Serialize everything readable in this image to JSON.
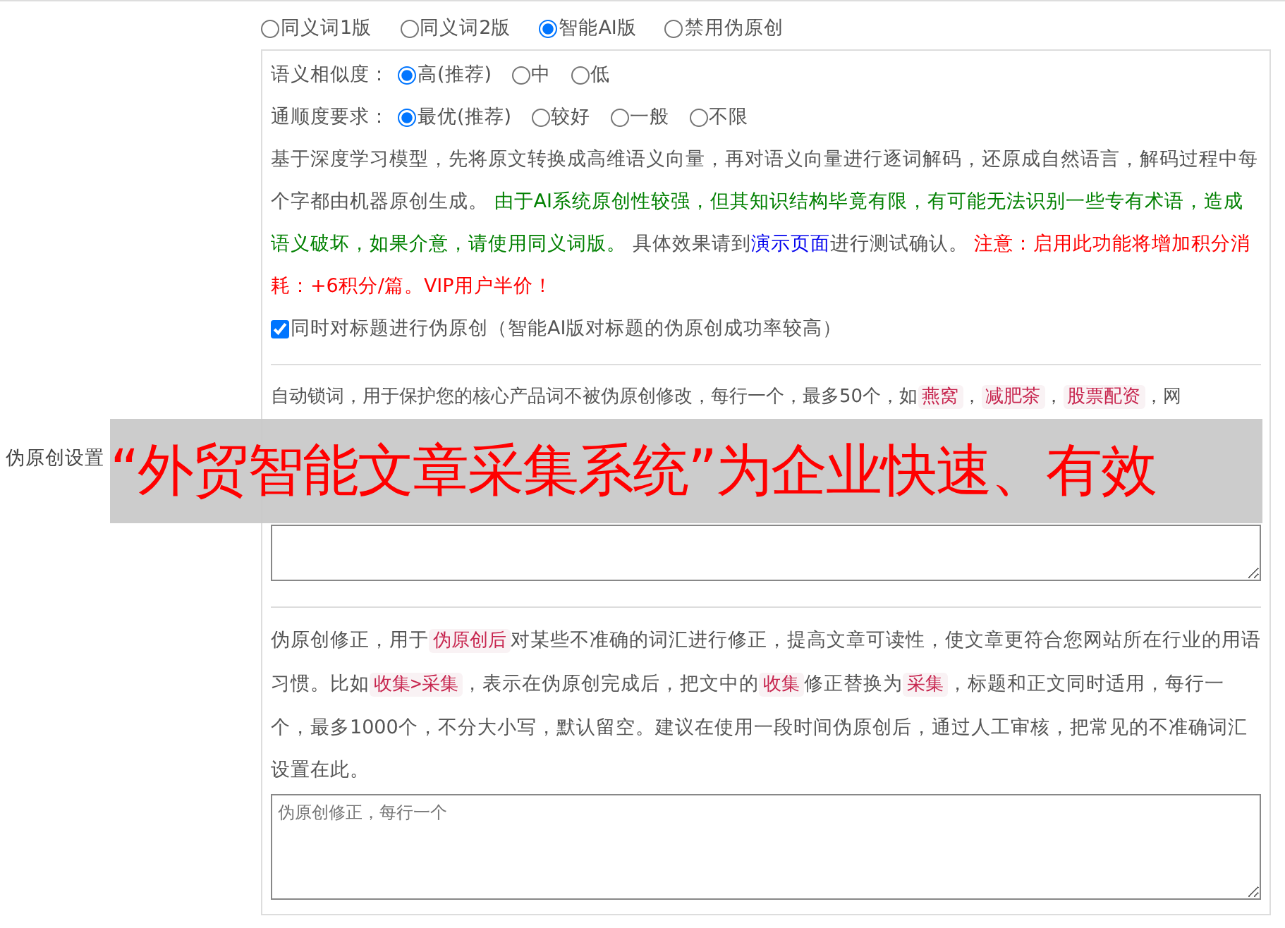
{
  "section_label": "伪原创设置",
  "modes": [
    {
      "label": "同义词1版",
      "selected": false
    },
    {
      "label": "同义词2版",
      "selected": false
    },
    {
      "label": "智能AI版",
      "selected": true
    },
    {
      "label": "禁用伪原创",
      "selected": false
    }
  ],
  "similarity": {
    "label": "语义相似度：",
    "options": [
      {
        "label": "高(推荐)",
        "selected": true
      },
      {
        "label": "中",
        "selected": false
      },
      {
        "label": "低",
        "selected": false
      }
    ]
  },
  "fluency": {
    "label": "通顺度要求：",
    "options": [
      {
        "label": "最优(推荐)",
        "selected": true
      },
      {
        "label": "较好",
        "selected": false
      },
      {
        "label": "一般",
        "selected": false
      },
      {
        "label": "不限",
        "selected": false
      }
    ]
  },
  "description": [
    {
      "kind": "plain",
      "text": "基于深度学习模型，先将原文转换成高维语义向量，再对语义向量进行逐词解码，还原成自然语言，解码过程中每个字都由机器原创生成。 "
    },
    {
      "kind": "green",
      "text": "由于AI系统原创性较强，但其知识结构毕竟有限，有可能无法识别一些专有术语，造成语义破坏，如果介意，请使用同义词版。"
    },
    {
      "kind": "plain",
      "text": " 具体效果请到"
    },
    {
      "kind": "link",
      "text": "演示页面"
    },
    {
      "kind": "plain",
      "text": "进行测试确认。 "
    },
    {
      "kind": "red",
      "text": "注意：启用此功能将增加积分消耗：+6积分/篇。VIP用户半价！"
    }
  ],
  "title_option": {
    "label": "同时对标题进行伪原创（智能AI版对标题的伪原创成功率较高）",
    "checked": true
  },
  "lock_words": [
    {
      "kind": "plain",
      "text": "自动锁词，用于保护您的核心产品词不被伪原创修改，每行一个，最多50个，如"
    },
    {
      "kind": "tag",
      "text": "燕窝"
    },
    {
      "kind": "plain",
      "text": "，"
    },
    {
      "kind": "tag",
      "text": "减肥茶"
    },
    {
      "kind": "plain",
      "text": "，"
    },
    {
      "kind": "tag",
      "text": "股票配资"
    },
    {
      "kind": "plain",
      "text": "，网"
    }
  ],
  "correction": [
    {
      "kind": "plain",
      "text": "伪原创修正，用于"
    },
    {
      "kind": "tag",
      "text": "伪原创后"
    },
    {
      "kind": "plain",
      "text": "对某些不准确的词汇进行修正，提高文章可读性，使文章更符合您网站所在行业的用语习惯。比如"
    },
    {
      "kind": "tag",
      "text": "收集>采集"
    },
    {
      "kind": "plain",
      "text": "，表示在伪原创完成后，把文中的"
    },
    {
      "kind": "tag",
      "text": "收集"
    },
    {
      "kind": "plain",
      "text": "修正替换为"
    },
    {
      "kind": "tag",
      "text": "采集"
    },
    {
      "kind": "plain",
      "text": "，标题和正文同时适用，每行一个，最多1000个，不分大小写，默认留空。建议在使用一段时间伪原创后，通过人工审核，把常见的不准确词汇设置在此。"
    }
  ],
  "correction_field": {
    "placeholder": "伪原创修正，每行一个"
  },
  "banner": {
    "text": "“外贸智能文章采集系统”为企业快速、有效"
  }
}
